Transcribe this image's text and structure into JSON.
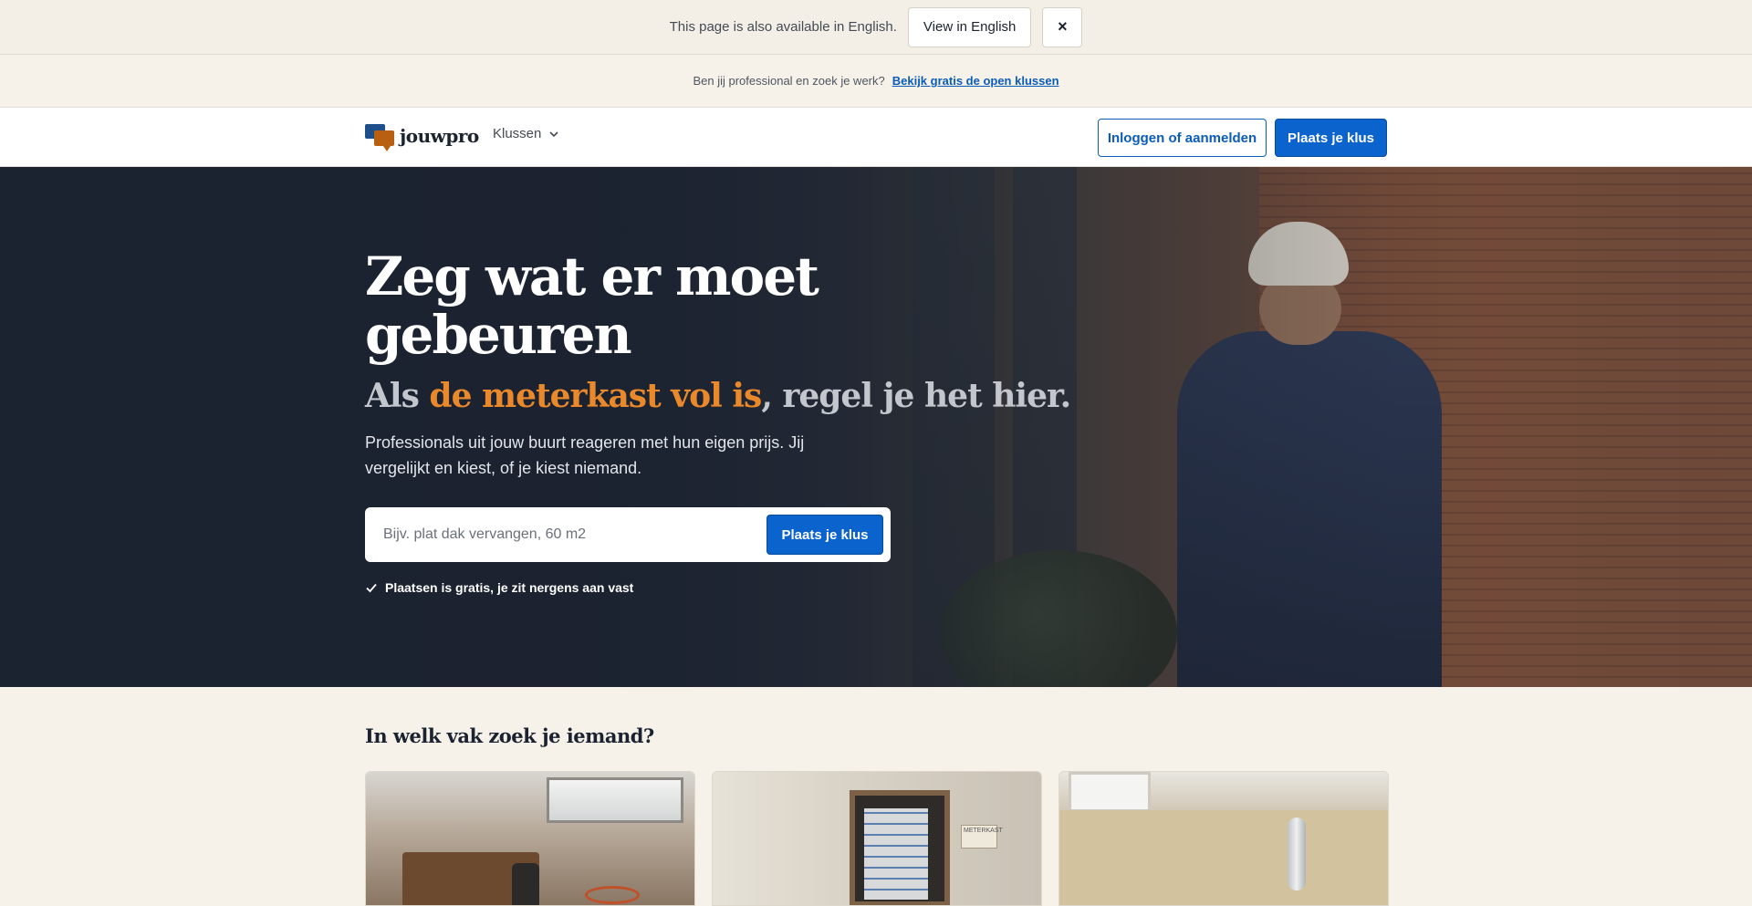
{
  "language_bar": {
    "message": "This page is also available in English.",
    "view_english_label": "View in English",
    "close_label": "×"
  },
  "pro_bar": {
    "question": "Ben jij professional en zoek je werk?",
    "link_label": "Bekijk gratis de open klussen"
  },
  "nav": {
    "logo_text": "jouwpro",
    "menu_label": "Klussen",
    "login_label": "Inloggen of aanmelden",
    "post_label": "Plaats je klus"
  },
  "hero": {
    "title": "Zeg wat er moet gebeuren",
    "subtitle_prefix": "Als ",
    "subtitle_highlight": "de meterkast vol is",
    "subtitle_suffix": ", regel je het hier.",
    "description": "Professionals uit jouw buurt reageren met hun eigen prijs. Jij vergelijkt en kiest, of je kiest niemand.",
    "search_placeholder": "Bijv. plat dak vervangen, 60 m2",
    "search_button_label": "Plaats je klus",
    "note": "Plaatsen is gratis, je zit nergens aan vast"
  },
  "categories": {
    "title": "In welk vak zoek je iemand?",
    "cards": [
      {
        "image": "toolbox-in-empty-room"
      },
      {
        "image": "meter-cabinet",
        "tag_text": "METERKAST"
      },
      {
        "image": "open-sink-cabinet-plumbing"
      }
    ]
  },
  "colors": {
    "accent_blue": "#0b63ce",
    "highlight_orange": "#e9892b",
    "hero_dark": "#1b2230",
    "page_bg": "#f6f2ea"
  }
}
